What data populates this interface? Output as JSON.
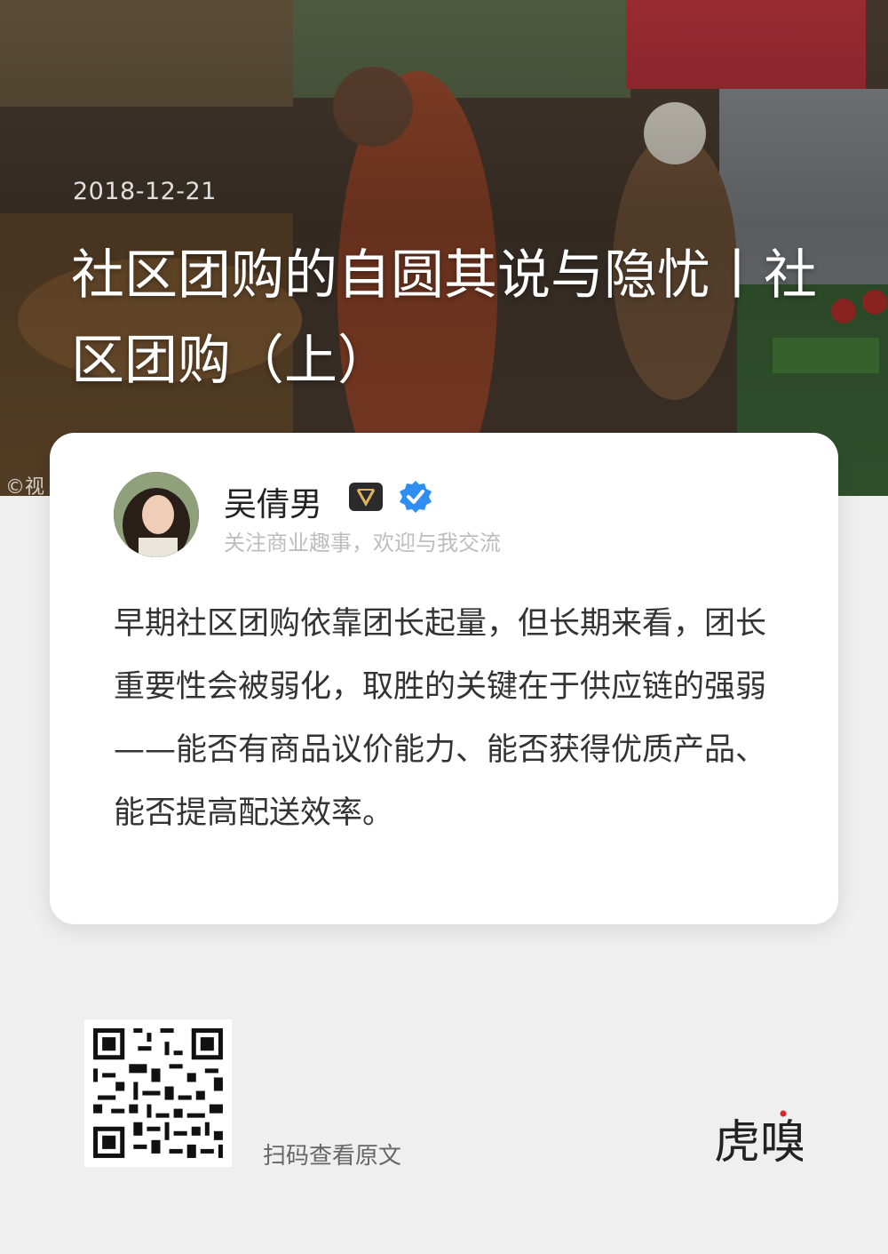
{
  "header": {
    "date": "2018-12-21",
    "title": "社区团购的自圆其说与隐忧丨社区团购（上）",
    "image_watermark": "©视"
  },
  "author": {
    "name": "吴倩男",
    "vip_badge": "V",
    "bio": "关注商业趣事，欢迎与我交流"
  },
  "excerpt": "早期社区团购依靠团长起量，但长期来看，团长重要性会被弱化，取胜的关键在于供应链的强弱——能否有商品议价能力、能否获得优质产品、能否提高配送效率。",
  "footer": {
    "scan_text": "扫码查看原文",
    "brand_logo_text": "虎嗅"
  },
  "colors": {
    "page_background": "#efefef",
    "card_background": "#ffffff",
    "verified_blue": "#2f8ef2",
    "logo_accent_red": "#d9252b"
  }
}
